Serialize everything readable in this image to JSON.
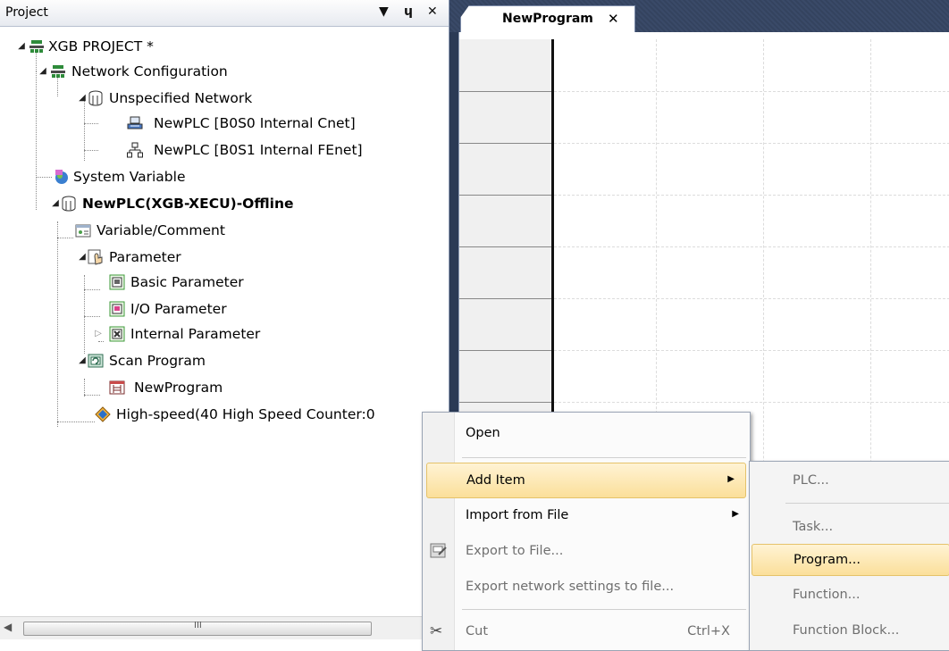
{
  "project_panel": {
    "title": "Project",
    "buttons": {
      "dropdown": "▼",
      "pin": "ᵖ",
      "close": "✕"
    }
  },
  "tree": {
    "root": "XGB PROJECT *",
    "network_config": "Network Configuration",
    "unspecified_network": "Unspecified Network",
    "plc_cnet": "NewPLC [B0S0 Internal Cnet]",
    "plc_fenet": "NewPLC [B0S1 Internal FEnet]",
    "system_variable": "System Variable",
    "plc_offline": "NewPLC(XGB-XECU)-Offline",
    "variable_comment": "Variable/Comment",
    "parameter": "Parameter",
    "basic_parameter": "Basic Parameter",
    "io_parameter": "I/O Parameter",
    "internal_parameter": "Internal Parameter",
    "scan_program": "Scan Program",
    "new_program": "NewProgram",
    "high_speed": "High-speed(40 High Speed Counter:0"
  },
  "scrollbar": {
    "grip": "III",
    "left_arrow": "◀"
  },
  "editor": {
    "tab_label": "NewProgram",
    "tab_close": "✕"
  },
  "context_menu": {
    "open": "Open",
    "add_item": "Add Item",
    "import_from_file": "Import from File",
    "export_to_file": "Export to File...",
    "export_network": "Export network settings to file...",
    "cut": "Cut",
    "cut_shortcut": "Ctrl+X"
  },
  "submenu": {
    "plc": "PLC...",
    "task": "Task...",
    "program": "Program...",
    "function": "Function...",
    "function_block": "Function Block..."
  },
  "colors": {
    "menu_hover_top": "#fff3d4",
    "menu_hover_bottom": "#fbdf9a",
    "editor_background": "#2b3a55",
    "panel_background": "#ffffff"
  }
}
